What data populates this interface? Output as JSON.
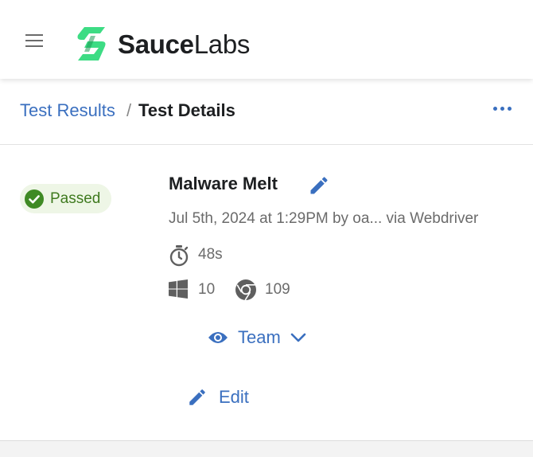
{
  "header": {
    "logo_text_bold": "Sauce",
    "logo_text_regular": "Labs",
    "brand_color": "#3ddc84",
    "menu_icon": "hamburger-menu-icon"
  },
  "breadcrumb": {
    "parent_label": "Test Results",
    "separator": "/",
    "current_label": "Test Details",
    "link_color": "#3a6fbf"
  },
  "test": {
    "status": "Passed",
    "status_color": "#3f7a1f",
    "status_bg": "#eef6e6",
    "name": "Malware Melt",
    "meta": "Jul 5th, 2024 at 1:29PM by oa... via Webdriver",
    "duration": "48s",
    "os_icon": "windows-icon",
    "os_version": "10",
    "browser_icon": "chrome-icon",
    "browser_version": "109"
  },
  "visibility": {
    "label": "Team",
    "icon": "eye-icon"
  },
  "actions": {
    "edit_label": "Edit"
  }
}
